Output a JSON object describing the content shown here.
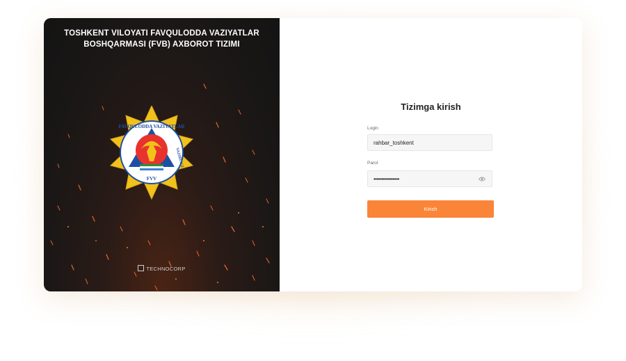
{
  "header": {
    "title_line1": "TOSHKENT VILOYATI FAVQULODDA VAZIYATLAR",
    "title_line2": "BOSHQARMASI (FVB) AXBOROT TIZIMI"
  },
  "emblem": {
    "text_top": "FAVQULODDA VAZIYATLAR",
    "text_right": "VAZIRLIGI",
    "text_bottom": "FVV"
  },
  "brand": {
    "name": "TECHNOCORP"
  },
  "login_form": {
    "title": "Tizimga kirish",
    "login_label": "Login",
    "login_value": "rahbar_toshkent",
    "password_label": "Parol",
    "password_value": "••••••••••••••••",
    "submit_label": "Kirish"
  },
  "colors": {
    "accent": "#fa8538",
    "left_panel_bg": "#1a1716"
  }
}
